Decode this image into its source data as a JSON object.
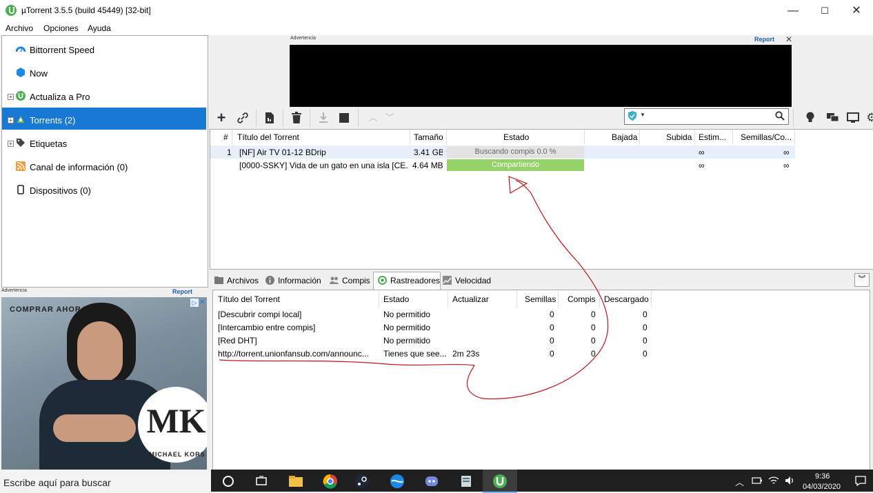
{
  "window": {
    "title": "µTorrent 3.5.5  (build 45449) [32-bit]",
    "minimize": "—",
    "maximize": "☐",
    "close": "✕"
  },
  "menu": [
    "Archivo",
    "Opciones",
    "Ayuda"
  ],
  "sidebar": {
    "items": [
      {
        "label": "Bittorrent Speed",
        "icon": "speed-gauge-icon"
      },
      {
        "label": "Now",
        "icon": "now-hexagon-icon"
      },
      {
        "label": "Actualiza a Pro",
        "icon": "utorrent-pro-icon"
      },
      {
        "label": "Torrents (2)",
        "icon": "torrents-icon"
      },
      {
        "label": "Etiquetas",
        "icon": "tag-icon"
      },
      {
        "label": "Canal de información (0)",
        "icon": "rss-icon"
      },
      {
        "label": "Dispositivos (0)",
        "icon": "device-icon"
      }
    ],
    "selected_index": 3
  },
  "ads": {
    "label": "Advertencia",
    "report": "Report",
    "close": "✕",
    "left_ad": {
      "brand_logo": "MK",
      "brand_name": "MICHAEL KORS",
      "headline": "COMPRAR AHORA"
    }
  },
  "toolbar": {
    "search_placeholder": "",
    "colors": {
      "accent": "#1779d4",
      "seeding": "#96d26a"
    }
  },
  "torrent_list": {
    "columns": [
      "#",
      "Título del Torrent",
      "Tamaño",
      "Estado",
      "Bajada",
      "Subida",
      "Estim...",
      "Semillas/Co..."
    ],
    "rows": [
      {
        "num": "1",
        "name": "[NF] Air TV 01-12 BDrip",
        "size": "3.41 GB",
        "status": "Buscando compis 0.0 %",
        "down": "",
        "up": "",
        "eta": "∞",
        "seeds": "∞"
      },
      {
        "num": "",
        "name": "[0000-SSKY] Vida de un gato en una isla [CE...",
        "size": "4.64 MB",
        "status": "Compartiendo",
        "down": "",
        "up": "",
        "eta": "∞",
        "seeds": "∞"
      }
    ]
  },
  "tabs": [
    {
      "label": "Archivos",
      "icon": "files-icon"
    },
    {
      "label": "Información",
      "icon": "info-icon"
    },
    {
      "label": "Compis",
      "icon": "peers-icon"
    },
    {
      "label": "Rastreadores",
      "icon": "trackers-icon"
    },
    {
      "label": "Velocidad",
      "icon": "speed-graph-icon"
    }
  ],
  "active_tab": "Rastreadores",
  "trackers": {
    "columns": [
      "Título del Torrent",
      "Estado",
      "Actualizar",
      "Semillas",
      "Compis",
      "Descargado"
    ],
    "rows": [
      {
        "name": "[Descubrir compi local]",
        "status": "No permitido",
        "update": "",
        "seeds": "0",
        "peers": "0",
        "downloaded": "0"
      },
      {
        "name": "[Intercambio entre compis]",
        "status": "No permitido",
        "update": "",
        "seeds": "0",
        "peers": "0",
        "downloaded": "0"
      },
      {
        "name": "[Red DHT]",
        "status": "No permitido",
        "update": "",
        "seeds": "0",
        "peers": "0",
        "downloaded": "0"
      },
      {
        "name": "http://torrent.unionfansub.com/announc...",
        "status": "Tienes que see...",
        "update": "2m 23s",
        "seeds": "0",
        "peers": "0",
        "downloaded": "0"
      }
    ]
  },
  "taskbar": {
    "search_text": "Escribe aquí para buscar",
    "time": "9:36",
    "date": "04/03/2020"
  }
}
